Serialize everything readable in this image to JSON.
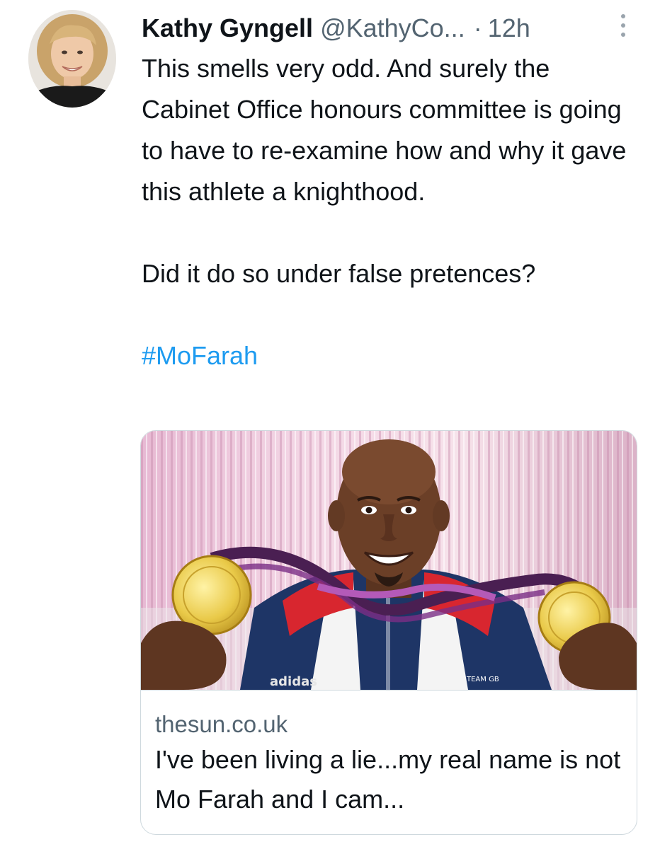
{
  "tweet": {
    "author": {
      "display_name": "Kathy Gyngell",
      "handle": "@KathyCo...",
      "separator": "·",
      "time": "12h",
      "avatar_icon": "user-avatar-photo"
    },
    "more_icon": "vertical-ellipsis-icon",
    "text": {
      "paragraph_1": "This smells very odd. And surely the Cabinet Office honours committee is going to have to re-examine how and why it gave this athlete a knighthood.",
      "paragraph_2": "Did it do so under false pretences?",
      "hashtag": "#MoFarah"
    },
    "link_card": {
      "image_icon": "article-photo",
      "image_logo_text": "adidas",
      "image_badge_text": "TEAM GB",
      "domain": "thesun.co.uk",
      "title": "I've been living a lie...my real name is not Mo Farah and I cam..."
    },
    "colors": {
      "link": "#1d9bf0",
      "secondary_text": "#536471",
      "primary_text": "#0f1419",
      "border": "#cfd9de"
    }
  }
}
